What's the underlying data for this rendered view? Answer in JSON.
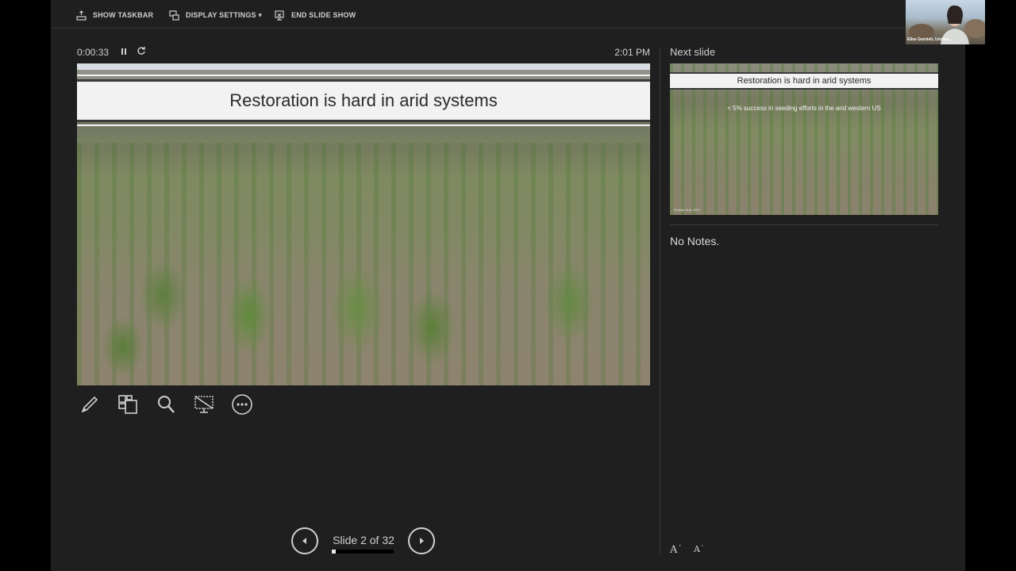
{
  "topbar": {
    "show_taskbar": "SHOW TASKBAR",
    "display_settings": "DISPLAY SETTINGS ▾",
    "end_slide_show": "END SLIDE SHOW"
  },
  "webcam": {
    "name": "Elise Gornish, Univers..."
  },
  "status": {
    "timer": "0:00:33",
    "clock": "2:01 PM"
  },
  "current_slide": {
    "title": "Restoration is hard in arid systems"
  },
  "navigation": {
    "counter": "Slide 2 of 32",
    "progress": 0.0625
  },
  "next_slide": {
    "label": "Next slide",
    "title": "Restoration is hard in arid systems",
    "subtitle": "< 5% success in seeding efforts in the arid western US",
    "citation": "Svejcar et al. 2017"
  },
  "notes": {
    "text": "No Notes."
  },
  "icons": {
    "tools": [
      "pen-icon",
      "slides-grid-icon",
      "zoom-icon",
      "black-screen-icon",
      "more-options-icon"
    ]
  }
}
